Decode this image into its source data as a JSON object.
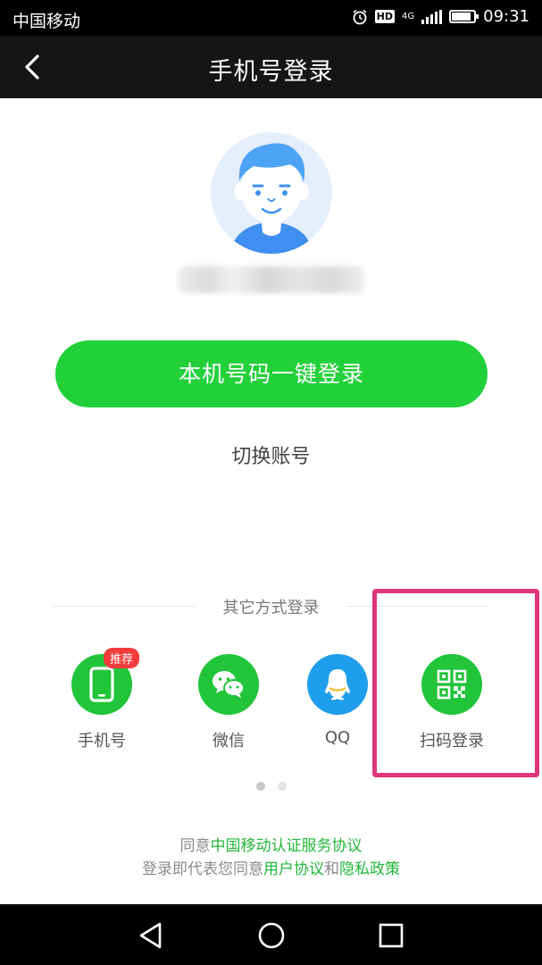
{
  "status_bar": {
    "carrier": "中国移动",
    "hd_label": "HD",
    "network_label": "4G",
    "time": "09:31",
    "battery_level": 0.85,
    "icons": [
      "alarm-icon",
      "hd-icon",
      "signal-icon",
      "battery-icon"
    ]
  },
  "nav": {
    "title": "手机号登录",
    "back_icon": "chevron-left-icon"
  },
  "main": {
    "primary_button": "本机号码一键登录",
    "switch_account": "切换账号"
  },
  "other_methods": {
    "title": "其它方式登录",
    "items": [
      {
        "label": "手机号",
        "icon": "phone-icon",
        "badge": "推荐"
      },
      {
        "label": "微信",
        "icon": "wechat-icon"
      },
      {
        "label": "QQ",
        "icon": "qq-icon"
      },
      {
        "label": "扫码登录",
        "icon": "qr-code-icon"
      }
    ]
  },
  "pagination": {
    "current_page": 1,
    "total_pages": 2
  },
  "agreement": {
    "line1_prefix": "同意",
    "line1_link": "中国移动认证服务协议",
    "line2_prefix": "登录即代表您同意",
    "line2_link1": "用户协议",
    "line2_join": "和",
    "line2_link2": "隐私政策"
  },
  "system_nav": [
    "back-triangle-icon",
    "home-circle-icon",
    "recents-square-icon"
  ],
  "colors": {
    "accent_green": "#22d13a",
    "link_green": "#22b83a",
    "qq_blue": "#1e9eec",
    "badge_red": "#f43b3b",
    "highlight_pink": "#e0357b"
  }
}
